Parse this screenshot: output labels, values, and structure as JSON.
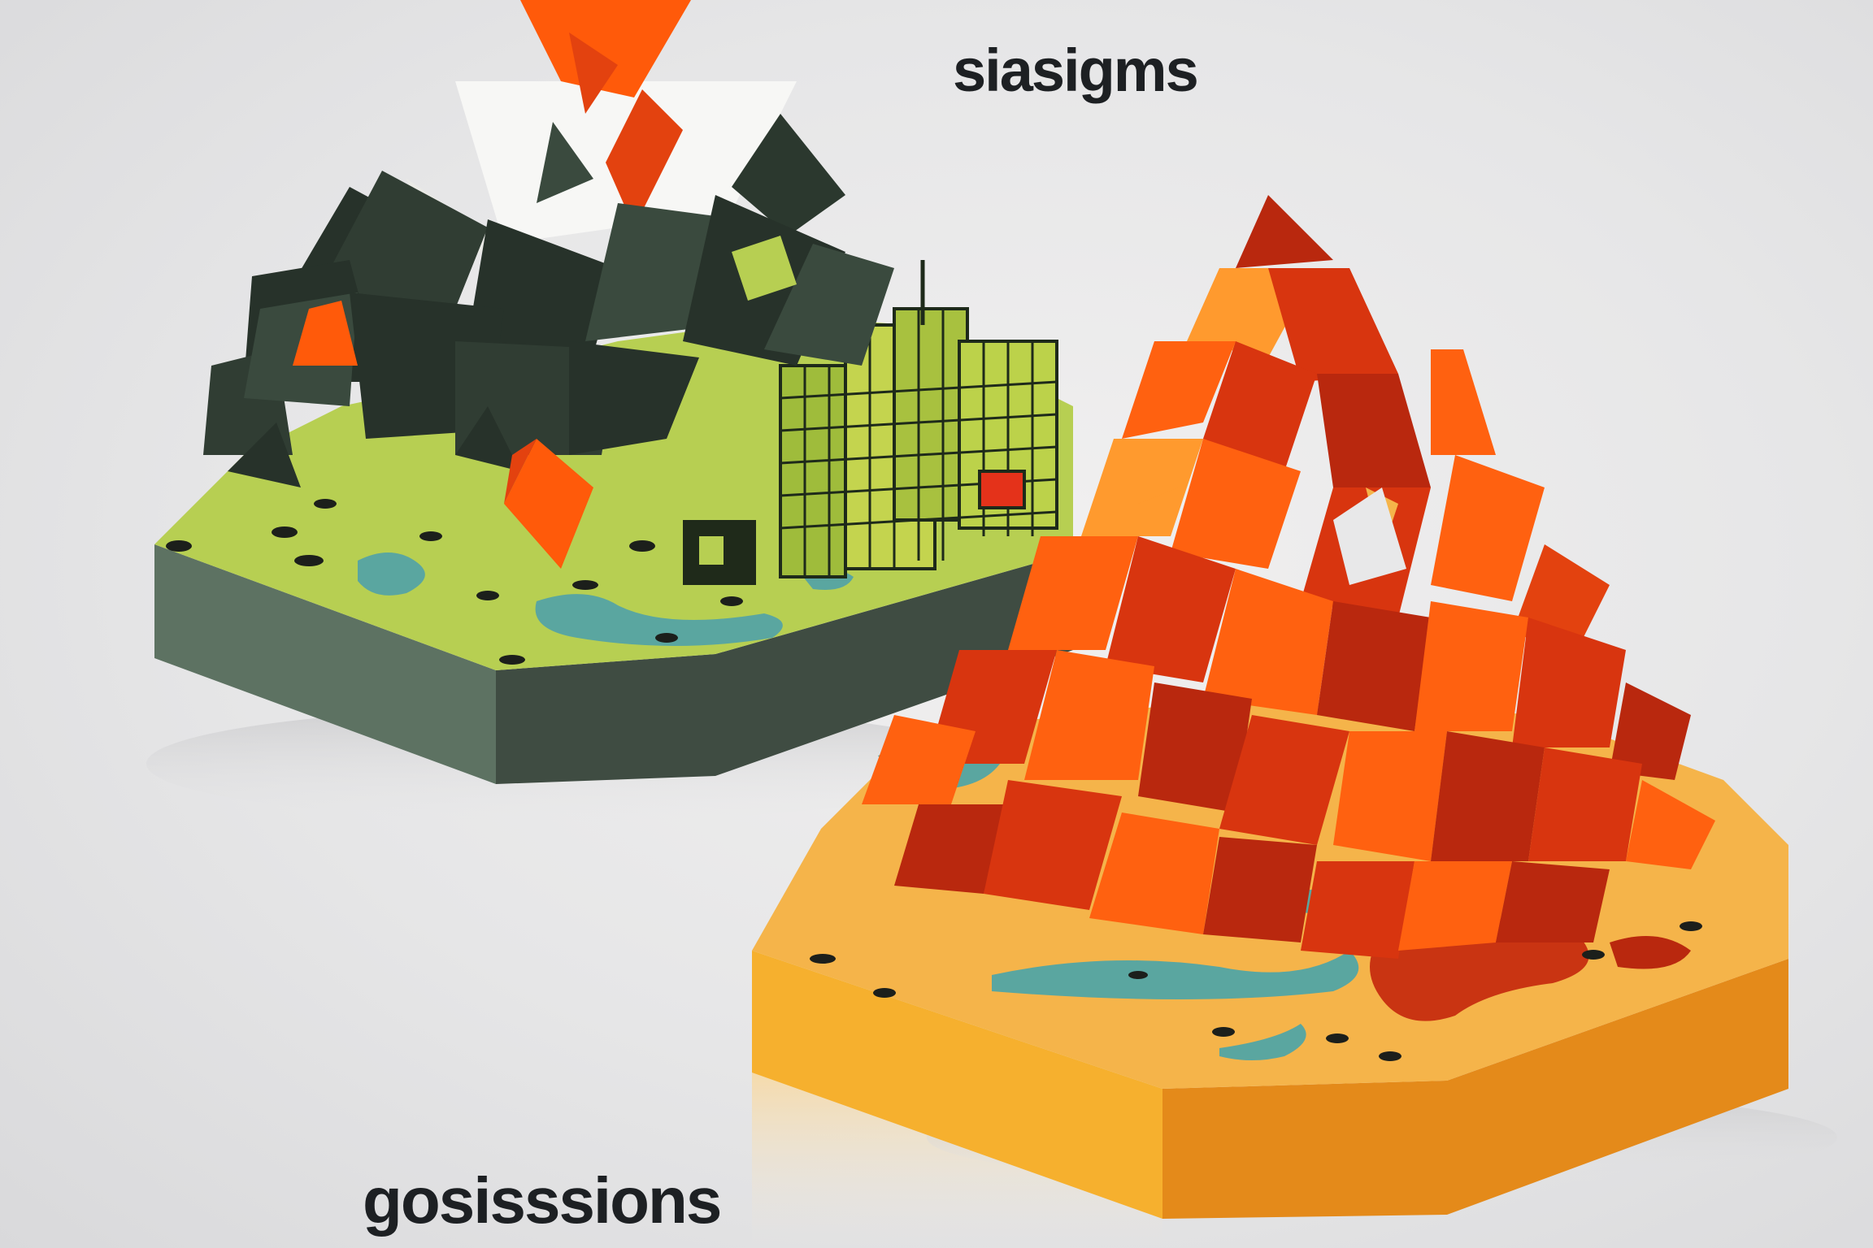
{
  "scene": {
    "description_free": true,
    "palette": {
      "background": "#e8e8e9",
      "left_side_wall": "#5d7262",
      "left_front_wall": "#3f4c42",
      "left_ground": "#b7cf52",
      "left_trees_dark": "#27322a",
      "left_trees_mid": "#3a4a3e",
      "snow": "#f7f7f5",
      "accent_orange": "#ff5a0a",
      "accent_red": "#e3420f",
      "water": "#5aa6a0",
      "building_lines": "#1e2a1a",
      "right_ground": "#f5b44a",
      "right_side_wall": "#f6b02e",
      "right_front_wall": "#e48a1a",
      "right_dark_red": "#b9280e",
      "right_red": "#d8350f",
      "right_orange": "#ff6110",
      "right_light_orange": "#ff9a2e",
      "text_color": "#1d2023"
    },
    "captions": {
      "top": "siasigms",
      "bottom": "gosisssions"
    }
  }
}
